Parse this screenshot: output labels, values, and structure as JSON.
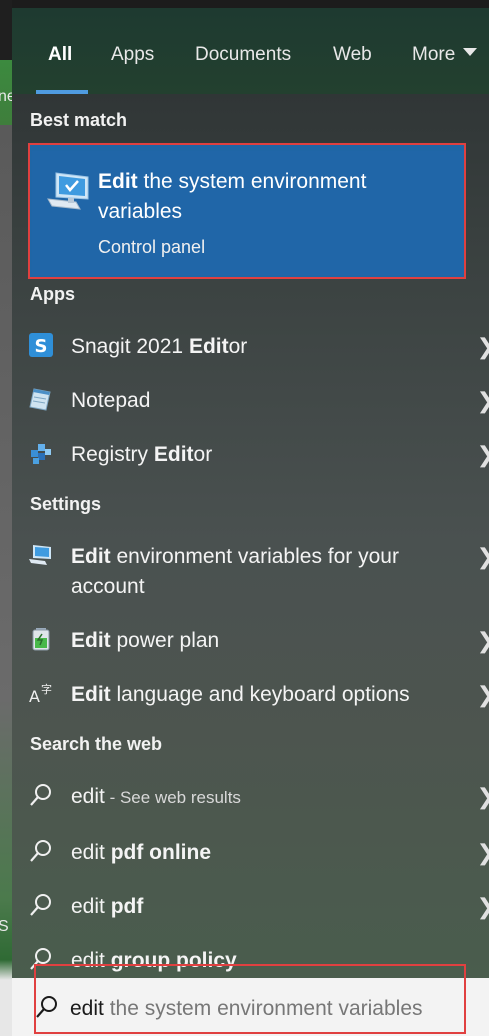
{
  "tabs": [
    {
      "label": "All",
      "active": true
    },
    {
      "label": "Apps"
    },
    {
      "label": "Documents"
    },
    {
      "label": "Web"
    },
    {
      "label": "More"
    }
  ],
  "bg_fragments": {
    "a": "ne",
    "b": "S"
  },
  "best_match": {
    "heading": "Best match",
    "title_bold": "Edit",
    "title_rest": " the system environment variables",
    "subtitle": "Control panel",
    "icon": "monitor-icon"
  },
  "apps": {
    "heading": "Apps",
    "items": [
      {
        "pre": "Snagit 2021 ",
        "bold": "Edit",
        "post": "or",
        "icon": "snagit-icon"
      },
      {
        "pre": "Notepad",
        "bold": "",
        "post": "",
        "icon": "notepad-icon"
      },
      {
        "pre": "Registry ",
        "bold": "Edit",
        "post": "or",
        "icon": "registry-icon"
      }
    ]
  },
  "settings": {
    "heading": "Settings",
    "items": [
      {
        "bold": "Edit",
        "post": " environment variables for your account",
        "icon": "monitor-settings-icon"
      },
      {
        "bold": "Edit",
        "post": " power plan",
        "icon": "battery-icon"
      },
      {
        "bold": "Edit",
        "post": " language and keyboard options",
        "icon": "language-icon"
      }
    ]
  },
  "web": {
    "heading": "Search the web",
    "items": [
      {
        "pre": "edit",
        "sub": " - See web results",
        "bold": ""
      },
      {
        "pre": "edit ",
        "sub": "",
        "bold": "pdf online"
      },
      {
        "pre": "edit ",
        "sub": "",
        "bold": "pdf"
      },
      {
        "pre": "edit ",
        "sub": "",
        "bold": "group policy"
      }
    ]
  },
  "search": {
    "typed": "edit",
    "suggestion": " the system environment variables"
  },
  "colors": {
    "accent": "#2066a8",
    "highlight_border": "#e04040",
    "tab_underline": "#4f9be0"
  }
}
